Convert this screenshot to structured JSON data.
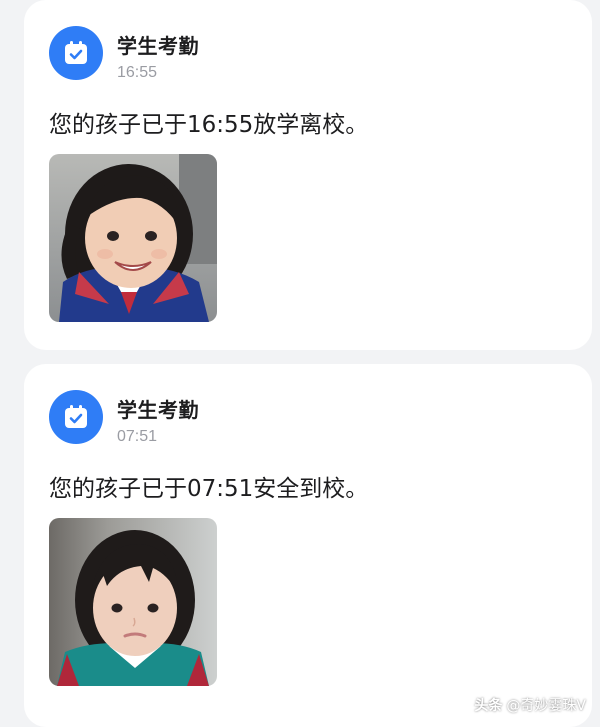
{
  "colors": {
    "background": "#f2f3f5",
    "card": "#ffffff",
    "accent": "#2f7df6",
    "text_primary": "#1d1d1f",
    "text_secondary": "#9a9ca3"
  },
  "notifications": [
    {
      "app_icon": "calendar-check-icon",
      "app_name": "学生考勤",
      "time": "16:55",
      "message": "您的孩子已于16:55放学离校。",
      "photo": "student-photo-leaving"
    },
    {
      "app_icon": "calendar-check-icon",
      "app_name": "学生考勤",
      "time": "07:51",
      "message": "您的孩子已于07:51安全到校。",
      "photo": "student-photo-arriving"
    }
  ],
  "watermark": {
    "brand": "头条",
    "handle": "@奇妙霎珠V"
  }
}
